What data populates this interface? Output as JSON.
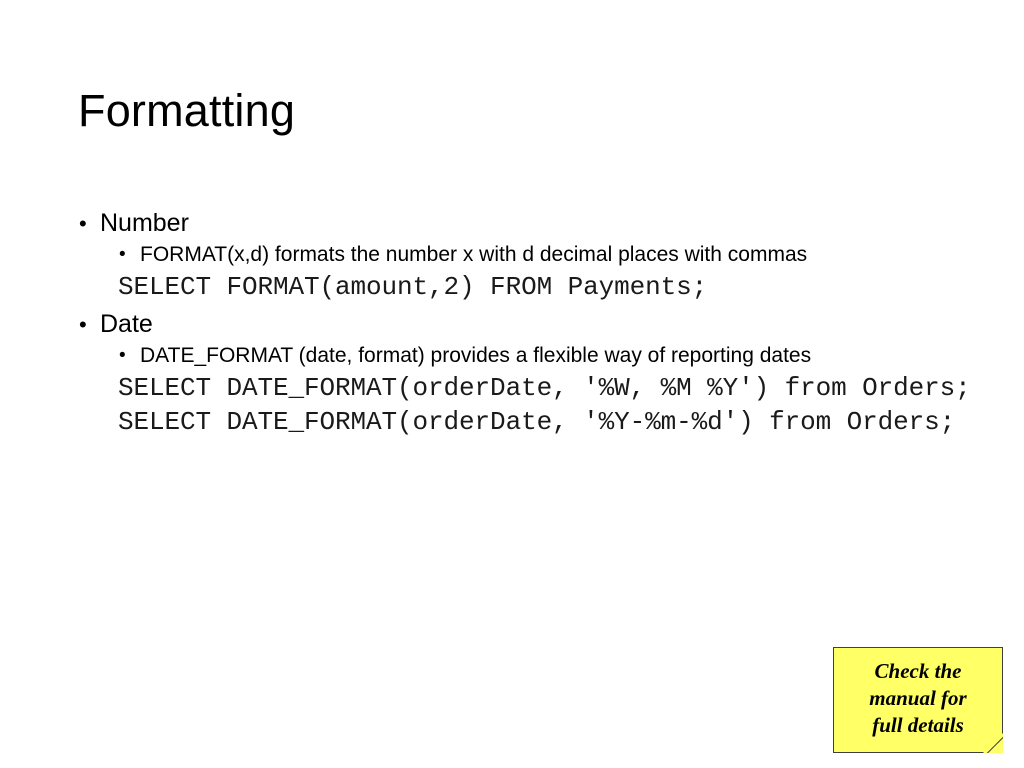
{
  "slide": {
    "title": "Formatting",
    "bullet_glyph": "•",
    "sections": [
      {
        "heading": "Number",
        "sub_bullets": [
          "FORMAT(x,d) formats the number x with d decimal places with commas"
        ],
        "code_lines": [
          "SELECT FORMAT(amount,2) FROM Payments;"
        ]
      },
      {
        "heading": "Date",
        "sub_bullets": [
          "DATE_FORMAT (date, format) provides a flexible way of reporting dates"
        ],
        "code_lines": [
          "SELECT DATE_FORMAT(orderDate, '%W, %M %Y') from Orders;",
          "SELECT DATE_FORMAT(orderDate, '%Y-%m-%d') from Orders;"
        ]
      }
    ]
  },
  "sticky_note": {
    "line1": "Check the",
    "line2": "manual for",
    "line3": "full details",
    "background_color": "#ffff66",
    "border_color": "#3f3f3f"
  }
}
